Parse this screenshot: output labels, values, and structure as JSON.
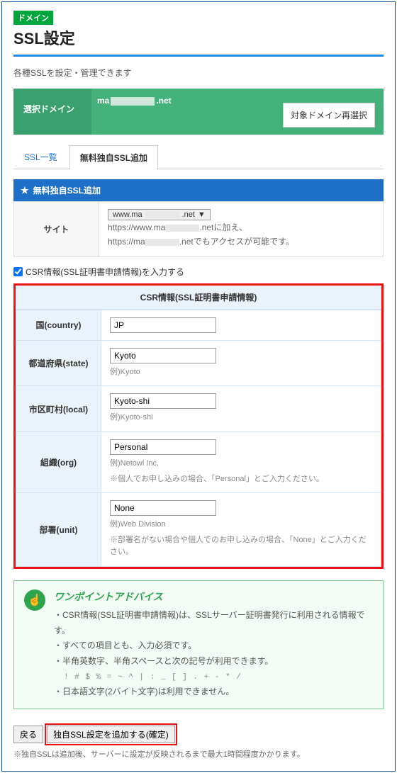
{
  "header": {
    "badge": "ドメイン",
    "title": "SSL設定",
    "description": "各種SSLを設定・管理できます"
  },
  "domain_bar": {
    "label": "選択ドメイン",
    "prefix": "ma",
    "suffix": ".net",
    "reselect": "対象ドメイン再選択"
  },
  "tabs": {
    "list": "SSL一覧",
    "add": "無料独自SSL追加"
  },
  "section_title": "無料独自SSL追加",
  "site": {
    "label": "サイト",
    "select_prefix": "www.ma",
    "select_mid": ".net",
    "select_marker": "▼",
    "note_l1_a": "https://www.ma",
    "note_l1_b": ".netに加え、",
    "note_l2_a": "https://ma",
    "note_l2_b": ".netでもアクセスが可能です。"
  },
  "csr_check_label": "CSR情報(SSL証明書申請情報)を入力する",
  "csr": {
    "title": "CSR情報(SSL証明書申請情報)",
    "country": {
      "label": "国(country)",
      "value": "JP"
    },
    "state": {
      "label": "都道府県(state)",
      "value": "Kyoto",
      "hint": "例)Kyoto"
    },
    "local": {
      "label": "市区町村(local)",
      "value": "Kyoto-shi",
      "hint": "例)Kyoto-shi"
    },
    "org": {
      "label": "組織(org)",
      "value": "Personal",
      "hint1": "例)Netowl Inc.",
      "hint2": "※個人でお申し込みの場合、「Personal」とご入力ください。"
    },
    "unit": {
      "label": "部署(unit)",
      "value": "None",
      "hint1": "例)Web Division",
      "hint2": "※部署名がない場合や個人でのお申し込みの場合、「None」とご入力ください。"
    }
  },
  "advice": {
    "heading": "ワンポイントアドバイス",
    "items": [
      "CSR情報(SSL証明書申請情報)は、SSLサーバー証明書発行に利用される情報です。",
      "すべての項目とも、入力必須です。",
      "半角英数字、半角スペースと次の記号が利用できます。",
      "日本語文字(2バイト文字)は利用できません。"
    ],
    "symbols": "! # $ % = ~ ^ | : _ [ ] . + - * /"
  },
  "footer": {
    "back": "戻る",
    "confirm": "独自SSL設定を追加する(確定)",
    "note": "※独自SSLは追加後、サーバーに設定が反映されるまで最大1時間程度かかります。"
  }
}
